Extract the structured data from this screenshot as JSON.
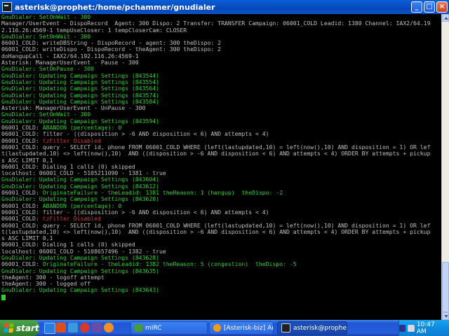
{
  "window": {
    "title": "asterisk@prophet:/home/pchammer/gnudialer",
    "buttons": {
      "minimize": "_",
      "maximize": "□",
      "close": "×"
    }
  },
  "terminal": {
    "lines": [
      [
        {
          "t": "GnuDialer: SetOnWait - 300",
          "c": "green"
        }
      ],
      [
        {
          "t": "Manager/UserEvent - DispoRecord  Agent: 300 Dispo: 2 Transfer: TRANSFER Campaign: 06001_COLD Leadid: 1380 Channel: IAX2/64.19",
          "c": ""
        }
      ],
      [
        {
          "t": "2.116.26:4569-1 tempUseCloser: 1 tempCloserCam: CLOSER",
          "c": ""
        }
      ],
      [
        {
          "t": "GnuDialer: SetOnWait - 300",
          "c": "green"
        }
      ],
      [
        {
          "t": "06001_COLD: writeDBString - DispoRecord - agent: 300 theDispo: 2",
          "c": ""
        }
      ],
      [
        {
          "t": "06001_COLD: writeDispo - DispoRecord - theAgent: 300 theDispo: 2",
          "c": ""
        }
      ],
      [
        {
          "t": "doHangupCall - IAX2/64.192.116.26:4569-1",
          "c": ""
        }
      ],
      [
        {
          "t": "Asterisk: ManagerUserEvent - Pause - 300",
          "c": ""
        }
      ],
      [
        {
          "t": "GnuDialer: SetOnPause - 300",
          "c": "green"
        }
      ],
      [
        {
          "t": "GnuDialer: Updating Campaign Settings (843544)",
          "c": "green"
        }
      ],
      [
        {
          "t": "GnuDialer: Updating Campaign Settings (843554)",
          "c": "green"
        }
      ],
      [
        {
          "t": "GnuDialer: Updating Campaign Settings (843564)",
          "c": "green"
        }
      ],
      [
        {
          "t": "GnuDialer: Updating Campaign Settings (843574)",
          "c": "green"
        }
      ],
      [
        {
          "t": "GnuDialer: Updating Campaign Settings (843584)",
          "c": "green"
        }
      ],
      [
        {
          "t": "Asterisk: ManagerUserEvent - UnPause - 300",
          "c": ""
        }
      ],
      [
        {
          "t": "GnuDialer: SetOnWait - 300",
          "c": "green"
        }
      ],
      [
        {
          "t": "GnuDialer: Updating Campaign Settings (843594)",
          "c": "green"
        }
      ],
      [
        {
          "t": "06001_COLD: ",
          "c": ""
        },
        {
          "t": "ABANDON (percentage): 0",
          "c": "green"
        }
      ],
      [
        {
          "t": "06001_COLD: filter - ((disposition > -6 AND disposition < 6) AND attempts < 4)",
          "c": ""
        }
      ],
      [
        {
          "t": "06001_COLD: ",
          "c": ""
        },
        {
          "t": "tzFilter Disabled",
          "c": "red"
        }
      ],
      [
        {
          "t": "06001_COLD: query - SELECT id, phone FROM 06001_COLD WHERE (left(lastupdated,10) = left(now(),10) AND disposition = 1) OR lef",
          "c": ""
        }
      ],
      [
        {
          "t": "t(lastupdated,10) <> left(now(),10)  AND ((disposition > -6 AND disposition < 6) AND attempts < 4) ORDER BY attempts + pickup",
          "c": ""
        }
      ],
      [
        {
          "t": "s ASC LIMIT 0,1",
          "c": ""
        }
      ],
      [
        {
          "t": "06001_COLD: Dialing 1 calls (0) skipped",
          "c": ""
        }
      ],
      [
        {
          "t": "localhost: 06001_COLD - 5105211090 - 1381 - true",
          "c": ""
        }
      ],
      [
        {
          "t": "GnuDialer: Updating Campaign Settings (843604)",
          "c": "green"
        }
      ],
      [
        {
          "t": "GnuDialer: Updating Campaign Settings (843612)",
          "c": "green"
        }
      ],
      [
        {
          "t": "06001_COLD: ",
          "c": ""
        },
        {
          "t": "OriginateFailure - theLeadid: 1381 theReason: 1 (hangup)  theDispo: -2",
          "c": "green"
        }
      ],
      [
        {
          "t": "GnuDialer: Updating Campaign Settings (843620)",
          "c": "green"
        }
      ],
      [
        {
          "t": "06001_COLD: ",
          "c": ""
        },
        {
          "t": "ABANDON (percentage): 0",
          "c": "green"
        }
      ],
      [
        {
          "t": "06001_COLD: filter - ((disposition > -6 AND disposition < 6) AND attempts < 4)",
          "c": ""
        }
      ],
      [
        {
          "t": "06001_COLD: ",
          "c": ""
        },
        {
          "t": "tzFilter Disabled",
          "c": "red"
        }
      ],
      [
        {
          "t": "06001_COLD: query - SELECT id, phone FROM 06001_COLD WHERE (left(lastupdated,10) = left(now(),10) AND disposition = 1) OR lef",
          "c": ""
        }
      ],
      [
        {
          "t": "t(lastupdated,10) <> left(now(),10)  AND ((disposition > -6 AND disposition < 6) AND attempts < 4) ORDER BY attempts + pickup",
          "c": ""
        }
      ],
      [
        {
          "t": "s ASC LIMIT 0,1",
          "c": ""
        }
      ],
      [
        {
          "t": "06001_COLD: Dialing 1 calls (0) skipped",
          "c": ""
        }
      ],
      [
        {
          "t": "localhost: 06001_COLD - 5108657496 - 1382 - true",
          "c": ""
        }
      ],
      [
        {
          "t": "GnuDialer: Updating Campaign Settings (843628)",
          "c": "green"
        }
      ],
      [
        {
          "t": "06001_COLD: ",
          "c": ""
        },
        {
          "t": "OriginateFailure - theLeadid: 1382 theReason: 5 (congestion)  theDispo: -5",
          "c": "green"
        }
      ],
      [
        {
          "t": "GnuDialer: Updating Campaign Settings (843635)",
          "c": "green"
        }
      ],
      [
        {
          "t": "theAgent: 300 - logoff attempt",
          "c": ""
        }
      ],
      [
        {
          "t": "theAgent: 300 - logged off",
          "c": ""
        }
      ],
      [
        {
          "t": "GnuDialer: Updating Campaign Settings (843643)",
          "c": "green"
        }
      ]
    ]
  },
  "taskbar": {
    "start_label": "start",
    "tasks": [
      {
        "label": "mIRC",
        "icon": "mirc-icon",
        "color": "#4a9a3a"
      },
      {
        "label": "[Asterisk-biz] Anyone...",
        "icon": "browser-icon",
        "color": "#f29a1a"
      },
      {
        "label": "asterisk@prophet:/h...",
        "icon": "terminal-icon",
        "color": "#202020"
      }
    ],
    "clock": "10:47 AM"
  },
  "colors": {
    "terminal_bg": "#000000",
    "terminal_default": "#c0c0c0",
    "terminal_green": "#2fd12f",
    "terminal_red": "#d23a3a"
  }
}
